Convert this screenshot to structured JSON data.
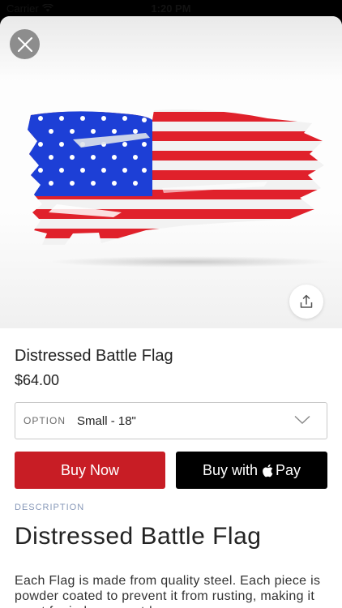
{
  "status_bar": {
    "carrier": "Carrier",
    "time": "1:20 PM"
  },
  "hero": {
    "close_icon": "close-icon",
    "share_icon": "share-icon",
    "image_subject": "distressed American flag"
  },
  "product": {
    "title": "Distressed Battle Flag",
    "price": "$64.00"
  },
  "option": {
    "label": "OPTION",
    "value": "Small - 18\""
  },
  "buttons": {
    "buy_now": "Buy Now",
    "apple_pay_prefix": "Buy with",
    "apple_pay_suffix": "Pay"
  },
  "description": {
    "label": "DESCRIPTION",
    "heading": "Distressed Battle Flag",
    "body": "Each Flag is made from quality steel. Each piece is powder coated to prevent it from rusting, making it great for indoor or outdoor use."
  },
  "colors": {
    "buy_now_bg": "#c81d25",
    "apple_pay_bg": "#000000",
    "flag_red": "#e0212b",
    "flag_blue": "#1d3fd6"
  }
}
